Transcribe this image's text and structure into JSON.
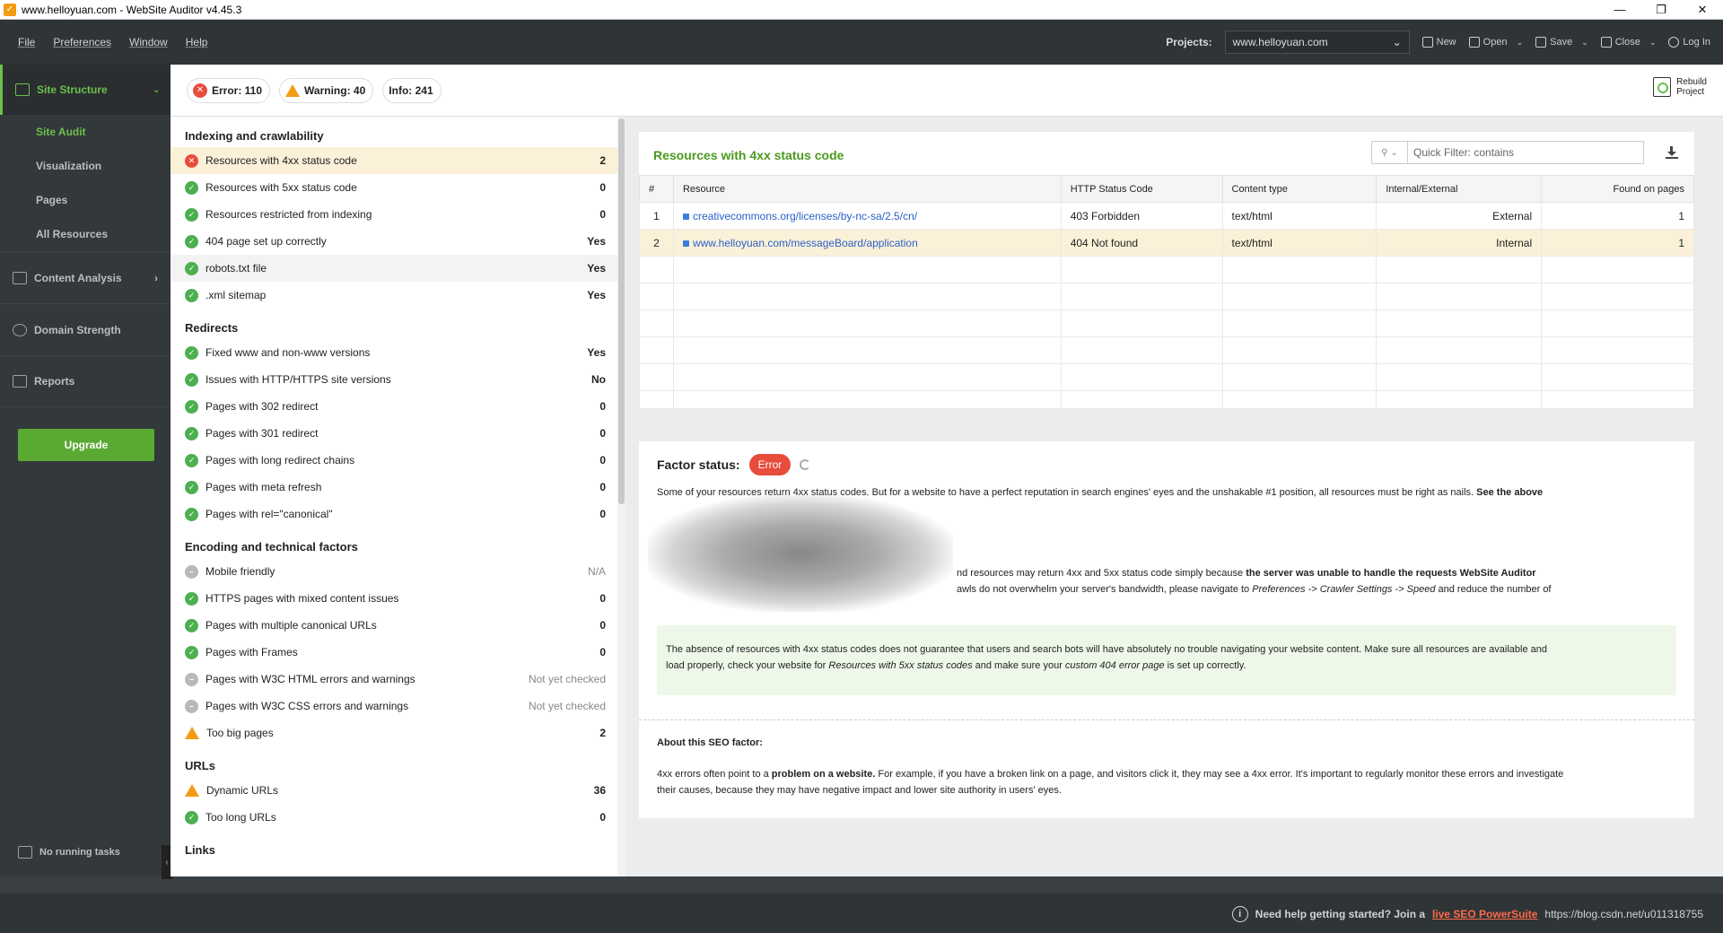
{
  "window": {
    "title": "www.helloyuan.com - WebSite Auditor v4.45.3",
    "controls": [
      "—",
      "❐",
      "✕"
    ]
  },
  "menu": [
    "File",
    "Preferences",
    "Window",
    "Help"
  ],
  "toolbar": {
    "projects_label": "Projects:",
    "project_value": "www.helloyuan.com",
    "new": "New",
    "open": "Open",
    "save": "Save",
    "close": "Close",
    "login": "Log In"
  },
  "sidebar": {
    "head": "Site Structure",
    "subitems": [
      "Site Audit",
      "Visualization",
      "Pages",
      "All Resources"
    ],
    "sections": [
      "Content Analysis",
      "Domain Strength",
      "Reports"
    ],
    "upgrade": "Upgrade",
    "tasks": "No running tasks"
  },
  "issues": {
    "error": "Error: 110",
    "warning": "Warning: 40",
    "info": "Info: 241"
  },
  "rebuild": {
    "line1": "Rebuild",
    "line2": "Project"
  },
  "factors": [
    {
      "group": "Indexing and crawlability",
      "items": [
        {
          "status": "err",
          "label": "Resources with 4xx status code",
          "value": "2"
        },
        {
          "status": "ok",
          "label": "Resources with 5xx status code",
          "value": "0"
        },
        {
          "status": "ok",
          "label": "Resources restricted from indexing",
          "value": "0"
        },
        {
          "status": "ok",
          "label": "404 page set up correctly",
          "value": "Yes"
        },
        {
          "status": "ok",
          "label": "robots.txt file",
          "value": "Yes"
        },
        {
          "status": "ok",
          "label": ".xml sitemap",
          "value": "Yes"
        }
      ]
    },
    {
      "group": "Redirects",
      "items": [
        {
          "status": "ok",
          "label": "Fixed www and non-www versions",
          "value": "Yes"
        },
        {
          "status": "ok",
          "label": "Issues with HTTP/HTTPS site versions",
          "value": "No"
        },
        {
          "status": "ok",
          "label": "Pages with 302 redirect",
          "value": "0"
        },
        {
          "status": "ok",
          "label": "Pages with 301 redirect",
          "value": "0"
        },
        {
          "status": "ok",
          "label": "Pages with long redirect chains",
          "value": "0"
        },
        {
          "status": "ok",
          "label": "Pages with meta refresh",
          "value": "0"
        },
        {
          "status": "ok",
          "label": "Pages with rel=\"canonical\"",
          "value": "0"
        }
      ]
    },
    {
      "group": "Encoding and technical factors",
      "items": [
        {
          "status": "na",
          "label": "Mobile friendly",
          "value": "N/A"
        },
        {
          "status": "ok",
          "label": "HTTPS pages with mixed content issues",
          "value": "0"
        },
        {
          "status": "ok",
          "label": "Pages with multiple canonical URLs",
          "value": "0"
        },
        {
          "status": "ok",
          "label": "Pages with Frames",
          "value": "0"
        },
        {
          "status": "na",
          "label": "Pages with W3C HTML errors and warnings",
          "value": "Not yet checked"
        },
        {
          "status": "na",
          "label": "Pages with W3C CSS errors and warnings",
          "value": "Not yet checked"
        },
        {
          "status": "warn",
          "label": "Too big pages",
          "value": "2"
        }
      ]
    },
    {
      "group": "URLs",
      "items": [
        {
          "status": "warn",
          "label": "Dynamic URLs",
          "value": "36"
        },
        {
          "status": "ok",
          "label": "Too long URLs",
          "value": "0"
        }
      ]
    },
    {
      "group": "Links",
      "items": []
    }
  ],
  "panel": {
    "title": "Resources with 4xx status code",
    "filter_placeholder": "Quick Filter: contains",
    "columns": [
      "#",
      "Resource",
      "HTTP Status Code",
      "Content type",
      "Internal/External",
      "Found on pages"
    ],
    "rows": [
      {
        "n": "1",
        "resource": "creativecommons.org/licenses/by-nc-sa/2.5/cn/",
        "status": "403 Forbidden",
        "type": "text/html",
        "ie": "External",
        "found": "1"
      },
      {
        "n": "2",
        "resource": "www.helloyuan.com/messageBoard/application",
        "status": "404 Not found",
        "type": "text/html",
        "ie": "Internal",
        "found": "1"
      }
    ]
  },
  "factor_info": {
    "label": "Factor status:",
    "badge": "Error",
    "p1": "Some of your resources return 4xx status codes. But for a website to have a perfect reputation in search engines' eyes and the unshakable #1 position, all resources must be right as nails.",
    "p1_bold": "See the above",
    "p2a": "nd resources may return 4xx and 5xx status code simply because",
    "p2_bold": "the server was unable to handle the requests WebSite Auditor",
    "p3a": "awls do not overwhelm your server's bandwidth, please navigate to",
    "p3_path": "Preferences -> Crawler Settings -> Speed",
    "p3b": "and reduce the number of",
    "green1": "The absence of resources with 4xx status codes does not guarantee that users and search bots will have absolutely no trouble navigating your website content. Make sure all resources are available and",
    "green2a": "load properly, check your website for",
    "green2_i1": "Resources with 5xx status codes",
    "green2b": "and make sure your",
    "green2_i2": "custom 404 error page",
    "green2c": "is set up correctly.",
    "about_title": "About this SEO factor:",
    "about1a": "4xx errors often point to a",
    "about1_bold": "problem on a website.",
    "about1b": "For example, if you have a broken link on a page, and visitors click it, they may see a 4xx error. It's important to regularly monitor these errors and investigate",
    "about2": "their causes, because they may have negative impact and lower site authority in users' eyes."
  },
  "statusbar": {
    "text": "Need help getting started? Join a",
    "link": "live SEO PowerSuite",
    "tail": "https://blog.csdn.net/u011318755"
  }
}
